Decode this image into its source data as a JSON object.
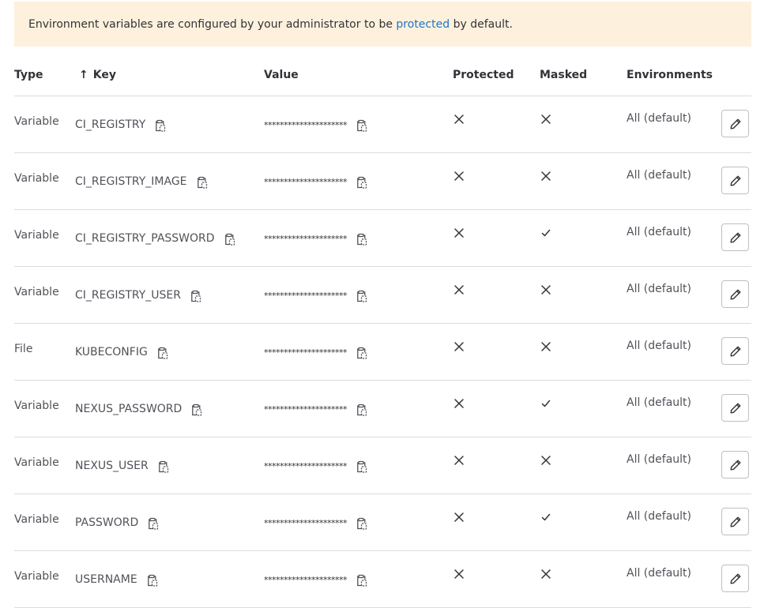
{
  "alert": {
    "text_before": "Environment variables are configured by your administrator to be",
    "link": "protected",
    "text_after": "by default."
  },
  "columns": {
    "type": "Type",
    "key": "Key",
    "value": "Value",
    "protected": "Protected",
    "masked": "Masked",
    "environments": "Environments"
  },
  "sort_icon": "arrow-up-icon",
  "rows": [
    {
      "type": "Variable",
      "key": "CI_REGISTRY",
      "value": "*********************",
      "protected": false,
      "masked": false,
      "environments": "All (default)"
    },
    {
      "type": "Variable",
      "key": "CI_REGISTRY_IMAGE",
      "value": "*********************",
      "protected": false,
      "masked": false,
      "environments": "All (default)"
    },
    {
      "type": "Variable",
      "key": "CI_REGISTRY_PASSWORD",
      "value": "*********************",
      "protected": false,
      "masked": true,
      "environments": "All (default)"
    },
    {
      "type": "Variable",
      "key": "CI_REGISTRY_USER",
      "value": "*********************",
      "protected": false,
      "masked": false,
      "environments": "All (default)"
    },
    {
      "type": "File",
      "key": "KUBECONFIG",
      "value": "*********************",
      "protected": false,
      "masked": false,
      "environments": "All (default)"
    },
    {
      "type": "Variable",
      "key": "NEXUS_PASSWORD",
      "value": "*********************",
      "protected": false,
      "masked": true,
      "environments": "All (default)"
    },
    {
      "type": "Variable",
      "key": "NEXUS_USER",
      "value": "*********************",
      "protected": false,
      "masked": false,
      "environments": "All (default)"
    },
    {
      "type": "Variable",
      "key": "PASSWORD",
      "value": "*********************",
      "protected": false,
      "masked": true,
      "environments": "All (default)"
    },
    {
      "type": "Variable",
      "key": "USERNAME",
      "value": "*********************",
      "protected": false,
      "masked": false,
      "environments": "All (default)"
    }
  ],
  "icons": {
    "copy": "clipboard-icon",
    "edit": "pencil-icon",
    "false": "close-icon",
    "true": "check-icon"
  },
  "colors": {
    "alert_bg": "#fdf1dd",
    "link": "#1f75cb",
    "text": "#333238",
    "border": "#dcdcde"
  }
}
